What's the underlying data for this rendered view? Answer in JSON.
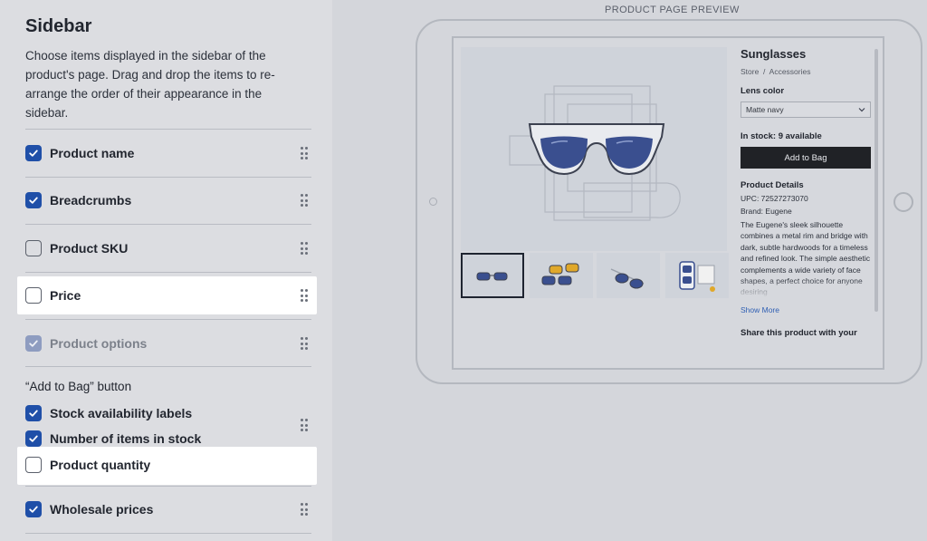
{
  "sidebar": {
    "title": "Sidebar",
    "description": "Choose items displayed in the sidebar of the product's page. Drag and drop the items to re-arrange the order of their appearance in the sidebar.",
    "items": [
      {
        "label": "Product name",
        "checked": true
      },
      {
        "label": "Breadcrumbs",
        "checked": true
      },
      {
        "label": "Product SKU",
        "checked": false
      },
      {
        "label": "Price",
        "checked": false,
        "highlighted": true
      },
      {
        "label": "Product options",
        "checked": true,
        "disabled": true
      }
    ],
    "group": {
      "title": "“Add to Bag” button",
      "items": [
        {
          "label": "Stock availability labels",
          "checked": true
        },
        {
          "label": "Number of items in stock",
          "checked": true
        },
        {
          "label": "Product quantity",
          "checked": false,
          "highlighted": true
        }
      ]
    },
    "wholesale": {
      "label": "Wholesale prices",
      "checked": true
    }
  },
  "preview": {
    "label": "PRODUCT PAGE PREVIEW",
    "product_title": "Sunglasses",
    "breadcrumb": "Store  /  Accessories",
    "lens_color_label": "Lens color",
    "lens_color_value": "Matte navy",
    "stock": "In stock: 9 available",
    "add_to_bag": "Add to Bag",
    "details_title": "Product Details",
    "upc": "UPC: 72527273070",
    "brand": "Brand: Eugene",
    "description": "The Eugene's sleek silhouette combines a metal rim and bridge with dark, subtle hardwoods for a timeless and refined look. The simple aesthetic complements a wide variety of face shapes, a perfect choice for anyone desiring",
    "show_more": "Show More",
    "share": "Share this product with your",
    "lens_color_hex": "#3a4f8f",
    "accent_yellow": "#e0a82a"
  }
}
